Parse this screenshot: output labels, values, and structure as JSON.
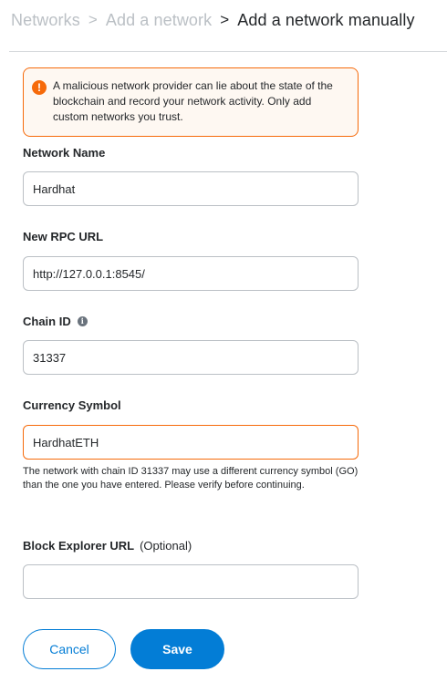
{
  "breadcrumb": {
    "items": [
      "Networks",
      "Add a network",
      "Add a network manually"
    ],
    "separator": ">"
  },
  "warning": {
    "icon": "exclamation-icon",
    "icon_glyph": "!",
    "text": "A malicious network provider can lie about the state of the blockchain and record your network activity. Only add custom networks you trust."
  },
  "form": {
    "network_name": {
      "label": "Network Name",
      "value": "Hardhat"
    },
    "rpc_url": {
      "label": "New RPC URL",
      "value": "http://127.0.0.1:8545/"
    },
    "chain_id": {
      "label": "Chain ID",
      "value": "31337",
      "info_icon_glyph": "i"
    },
    "currency_symbol": {
      "label": "Currency Symbol",
      "value": "HardhatETH",
      "warning": "The network with chain ID 31337 may use a different currency symbol (GO) than the one you have entered. Please verify before continuing."
    },
    "block_explorer": {
      "label": "Block Explorer URL",
      "optional": "(Optional)",
      "value": ""
    }
  },
  "buttons": {
    "cancel": "Cancel",
    "save": "Save"
  },
  "colors": {
    "primary": "#037dd6",
    "warning": "#f66a0a",
    "warning_bg": "#fef8f2",
    "muted_text": "#bbc0c5",
    "text": "#24272a",
    "border": "#bbc0c5"
  }
}
